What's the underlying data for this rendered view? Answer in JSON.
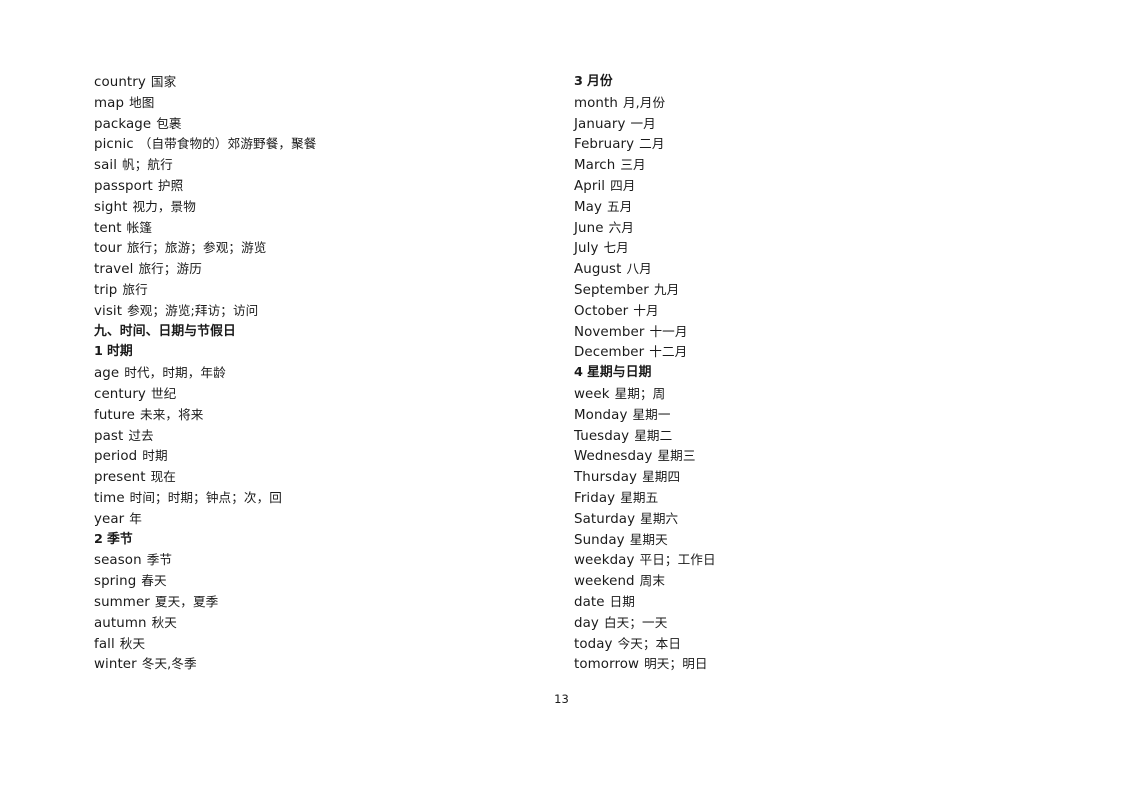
{
  "document": {
    "page_number": "13",
    "columns": [
      {
        "id": "left",
        "entries": [
          {
            "term": "country",
            "gloss": "国家",
            "heading": false
          },
          {
            "term": "map",
            "gloss": "地图",
            "heading": false
          },
          {
            "term": "package",
            "gloss": "包裹",
            "heading": false
          },
          {
            "term": "picnic",
            "gloss": "（自带食物的）郊游野餐，聚餐",
            "heading": false
          },
          {
            "term": "sail",
            "gloss": "帆；航行",
            "heading": false
          },
          {
            "term": "passport",
            "gloss": "护照",
            "heading": false
          },
          {
            "term": "sight",
            "gloss": "视力，景物",
            "heading": false
          },
          {
            "term": "tent",
            "gloss": "帐篷",
            "heading": false
          },
          {
            "term": "tour",
            "gloss": "旅行；旅游；参观；游览",
            "heading": false
          },
          {
            "term": "travel",
            "gloss": "旅行；游历",
            "heading": false
          },
          {
            "term": "trip",
            "gloss": "旅行",
            "heading": false
          },
          {
            "term": "visit",
            "gloss": "参观；游览;拜访；访问",
            "heading": false
          },
          {
            "term": "九、时间、日期与节假日",
            "gloss": "",
            "heading": true
          },
          {
            "term": "1",
            "gloss": "时期",
            "heading": true
          },
          {
            "term": "age",
            "gloss": "时代，时期，年龄",
            "heading": false
          },
          {
            "term": "century",
            "gloss": "世纪",
            "heading": false
          },
          {
            "term": "future",
            "gloss": "未来，将来",
            "heading": false
          },
          {
            "term": "past",
            "gloss": "过去",
            "heading": false
          },
          {
            "term": "period",
            "gloss": "时期",
            "heading": false
          },
          {
            "term": "present",
            "gloss": "现在",
            "heading": false
          },
          {
            "term": "time",
            "gloss": "时间；时期；钟点；次，回",
            "heading": false
          },
          {
            "term": "year",
            "gloss": "年",
            "heading": false
          },
          {
            "term": "2",
            "gloss": "季节",
            "heading": true
          },
          {
            "term": "season",
            "gloss": "季节",
            "heading": false
          },
          {
            "term": "spring",
            "gloss": "春天",
            "heading": false
          },
          {
            "term": "summer",
            "gloss": "夏天，夏季",
            "heading": false
          },
          {
            "term": "autumn",
            "gloss": "秋天",
            "heading": false
          },
          {
            "term": "fall",
            "gloss": "秋天",
            "heading": false
          },
          {
            "term": "winter",
            "gloss": "冬天,冬季",
            "heading": false
          }
        ]
      },
      {
        "id": "right",
        "entries": [
          {
            "term": "3",
            "gloss": "月份",
            "heading": true
          },
          {
            "term": "month",
            "gloss": "月,月份",
            "heading": false
          },
          {
            "term": "January",
            "gloss": "一月",
            "heading": false
          },
          {
            "term": "February",
            "gloss": "二月",
            "heading": false
          },
          {
            "term": "March",
            "gloss": "三月",
            "heading": false
          },
          {
            "term": "April",
            "gloss": "四月",
            "heading": false
          },
          {
            "term": "May",
            "gloss": "五月",
            "heading": false
          },
          {
            "term": "June",
            "gloss": "六月",
            "heading": false
          },
          {
            "term": "July",
            "gloss": "七月",
            "heading": false
          },
          {
            "term": "August",
            "gloss": "八月",
            "heading": false
          },
          {
            "term": "September",
            "gloss": "九月",
            "heading": false
          },
          {
            "term": "October",
            "gloss": "十月",
            "heading": false
          },
          {
            "term": "November",
            "gloss": "十一月",
            "heading": false
          },
          {
            "term": "December",
            "gloss": "十二月",
            "heading": false
          },
          {
            "term": "4",
            "gloss": "星期与日期",
            "heading": true
          },
          {
            "term": "week",
            "gloss": "星期；周",
            "heading": false
          },
          {
            "term": "Monday",
            "gloss": "星期一",
            "heading": false
          },
          {
            "term": "Tuesday",
            "gloss": "星期二",
            "heading": false
          },
          {
            "term": "Wednesday",
            "gloss": "星期三",
            "heading": false
          },
          {
            "term": "Thursday",
            "gloss": "星期四",
            "heading": false
          },
          {
            "term": "Friday",
            "gloss": "星期五",
            "heading": false
          },
          {
            "term": "Saturday",
            "gloss": "星期六",
            "heading": false
          },
          {
            "term": "Sunday",
            "gloss": "星期天",
            "heading": false
          },
          {
            "term": "weekday",
            "gloss": "平日；工作日",
            "heading": false
          },
          {
            "term": "weekend",
            "gloss": "周末",
            "heading": false
          },
          {
            "term": "date",
            "gloss": "日期",
            "heading": false
          },
          {
            "term": "day",
            "gloss": "白天；一天",
            "heading": false
          },
          {
            "term": "today",
            "gloss": "今天；本日",
            "heading": false
          },
          {
            "term": "tomorrow",
            "gloss": "明天；明日",
            "heading": false
          }
        ]
      }
    ]
  }
}
